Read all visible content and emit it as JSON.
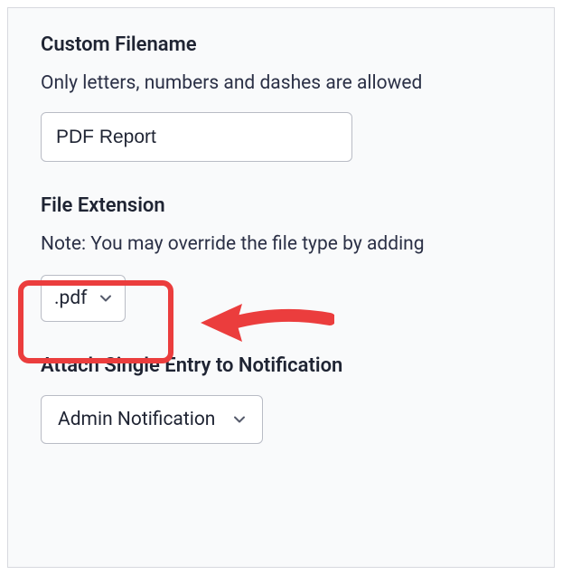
{
  "custom_filename": {
    "label": "Custom Filename",
    "helper": "Only letters, numbers and dashes are allowed",
    "value": "PDF Report"
  },
  "file_extension": {
    "label": "File Extension",
    "helper": "Note: You may override the file type by adding",
    "selected": ".pdf"
  },
  "attach": {
    "label": "Attach Single Entry to Notification",
    "selected": "Admin Notification"
  },
  "annotation": {
    "highlight_color": "#eb3d3d"
  }
}
